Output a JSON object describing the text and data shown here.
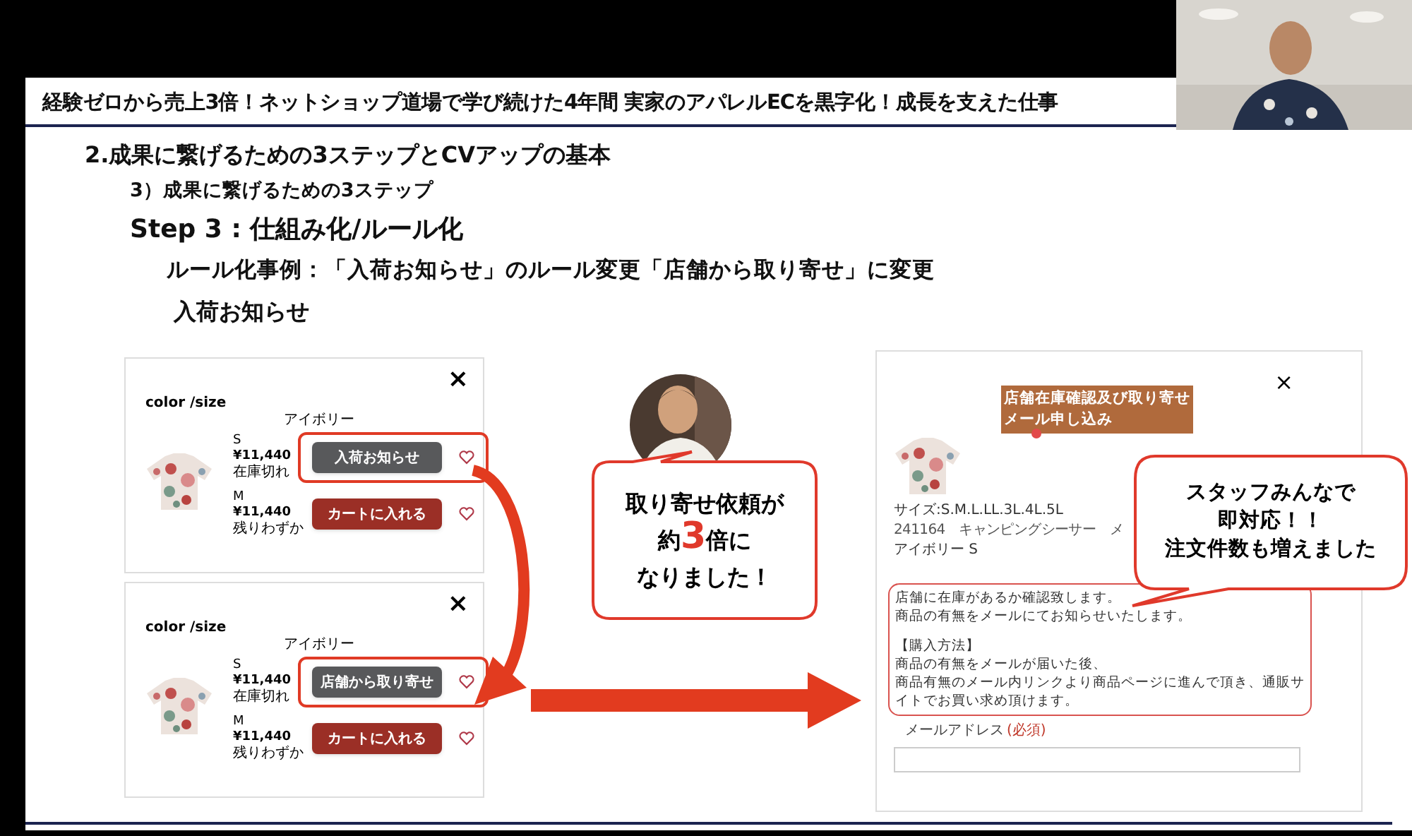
{
  "slide": {
    "title": "経験ゼロから売上3倍！ネットショップ道場で学び続けた4年間 実家のアパレルECを黒字化！成長を支えた仕事",
    "heading": "2.成果に繋げるための3ステップとCVアップの基本",
    "subheading": "3）成果に繋げるための3ステップ",
    "step": "Step 3 : 仕組み化/ルール化",
    "example": "ルール化事例：「入荷お知らせ」のルール変更「店舗から取り寄せ」に変更",
    "section_label": "入荷お知らせ"
  },
  "product_cards": [
    {
      "label": "color /size",
      "color_name": "アイボリー",
      "close": "×",
      "sizes": [
        {
          "size": "S",
          "price": "¥11,440",
          "stock": "在庫切れ",
          "button": "入荷お知らせ",
          "kind": "notify",
          "highlighted": true
        },
        {
          "size": "M",
          "price": "¥11,440",
          "stock": "残りわずか",
          "button": "カートに入れる",
          "kind": "cart",
          "highlighted": false
        }
      ]
    },
    {
      "label": "color /size",
      "color_name": "アイボリー",
      "close": "×",
      "sizes": [
        {
          "size": "S",
          "price": "¥11,440",
          "stock": "在庫切れ",
          "button": "店舗から取り寄せ",
          "kind": "notify",
          "highlighted": true
        },
        {
          "size": "M",
          "price": "¥11,440",
          "stock": "残りわずか",
          "button": "カートに入れる",
          "kind": "cart",
          "highlighted": false
        }
      ]
    }
  ],
  "callout_left": {
    "lines": [
      [
        {
          "text": "取り寄せ依頼が",
          "emphasis": false
        }
      ],
      [
        {
          "text": "約",
          "emphasis": false
        },
        {
          "text": "3",
          "emphasis": true
        },
        {
          "text": "倍に",
          "emphasis": false
        }
      ],
      [
        {
          "text": "なりました！",
          "emphasis": false
        }
      ]
    ]
  },
  "request_form": {
    "close": "×",
    "title_lines": [
      "店舗在庫確認及び取り寄せ",
      "メール申し込み"
    ],
    "sizes": "サイズ:S.M.L.LL.3L.4L.5L",
    "product": "241164　キャンピングシーサー　メ",
    "variant": "アイボリー S",
    "notice_lines": [
      "店舗に在庫があるか確認致します。",
      "商品の有無をメールにてお知らせいたします。"
    ],
    "purchase_heading": "【購入方法】",
    "purchase_lines": [
      "商品の有無をメールが届いた後、",
      "商品有無のメール内リンクより商品ページに進んで頂き、通販サイトでお買い求め頂けます。"
    ],
    "email_label": "メールアドレス",
    "required": "(必須)"
  },
  "callout_right": {
    "lines": [
      "スタッフみんなで",
      "即対応！！",
      "注文件数も増えました"
    ]
  }
}
